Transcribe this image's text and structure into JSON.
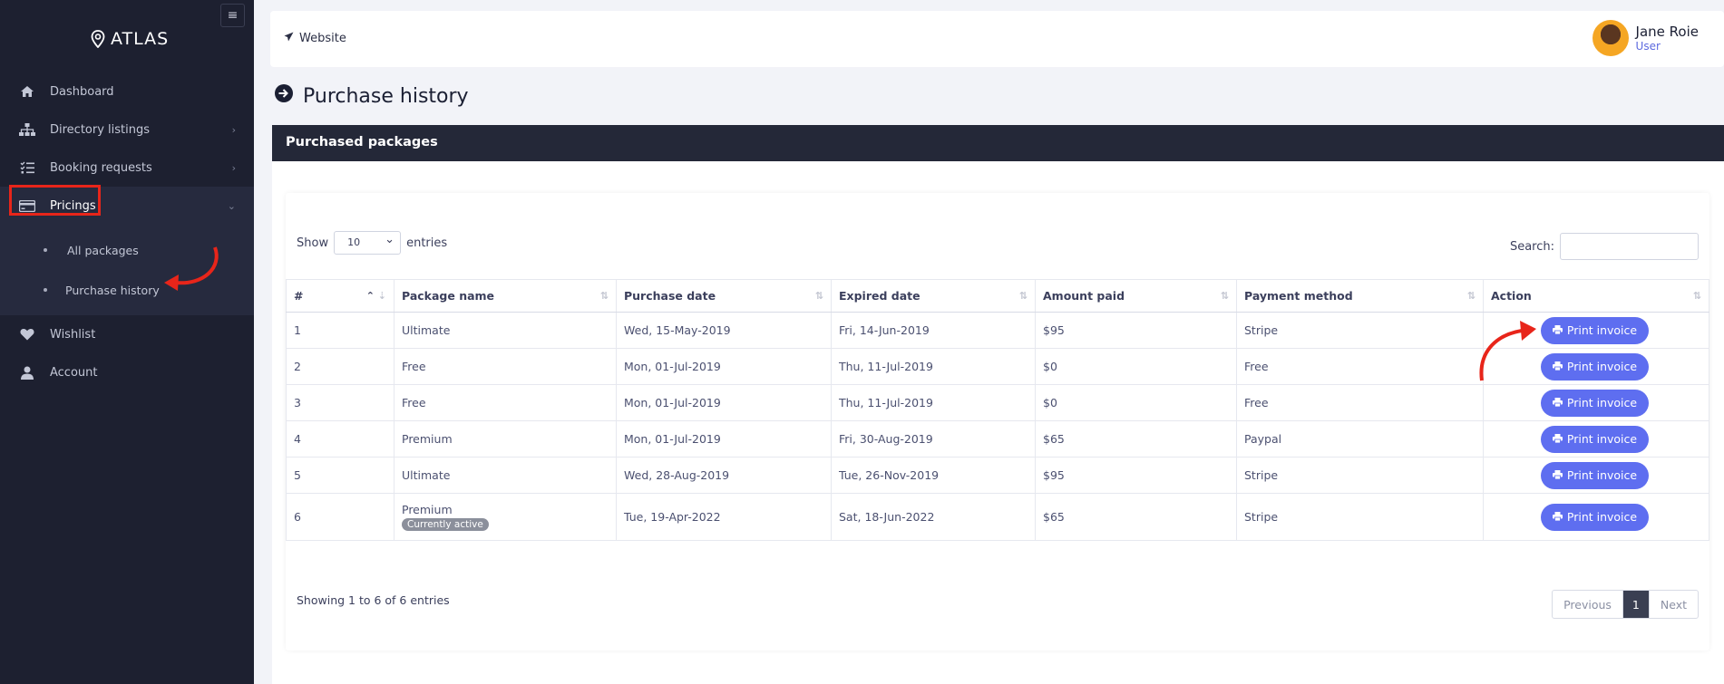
{
  "app": {
    "logo_text": "ATLAS"
  },
  "sidebar": {
    "items": [
      {
        "label": "Dashboard",
        "icon": "home-icon"
      },
      {
        "label": "Directory listings",
        "icon": "sitemap-icon"
      },
      {
        "label": "Booking requests",
        "icon": "tasks-icon"
      },
      {
        "label": "Pricings",
        "icon": "credit-card-icon",
        "active": true
      },
      {
        "label": "Wishlist",
        "icon": "heart-icon"
      },
      {
        "label": "Account",
        "icon": "user-icon"
      }
    ],
    "submenu": [
      {
        "label": "All packages"
      },
      {
        "label": "Purchase history",
        "active": true
      }
    ]
  },
  "topbar": {
    "website_label": "Website",
    "user_name": "Jane Roie",
    "user_role": "User"
  },
  "page": {
    "title": "Purchase history"
  },
  "card": {
    "header": "Purchased packages"
  },
  "table_controls": {
    "show_label": "Show",
    "show_value": "10",
    "entries_label": "entries",
    "search_label": "Search:"
  },
  "table": {
    "columns": [
      "#",
      "Package name",
      "Purchase date",
      "Expired date",
      "Amount paid",
      "Payment method",
      "Action"
    ],
    "rows": [
      {
        "num": "1",
        "package": "Ultimate",
        "purchase": "Wed, 15-May-2019",
        "expired": "Fri, 14-Jun-2019",
        "amount": "$95",
        "method": "Stripe",
        "action": "Print invoice"
      },
      {
        "num": "2",
        "package": "Free",
        "purchase": "Mon, 01-Jul-2019",
        "expired": "Thu, 11-Jul-2019",
        "amount": "$0",
        "method": "Free",
        "action": "Print invoice"
      },
      {
        "num": "3",
        "package": "Free",
        "purchase": "Mon, 01-Jul-2019",
        "expired": "Thu, 11-Jul-2019",
        "amount": "$0",
        "method": "Free",
        "action": "Print invoice"
      },
      {
        "num": "4",
        "package": "Premium",
        "purchase": "Mon, 01-Jul-2019",
        "expired": "Fri, 30-Aug-2019",
        "amount": "$65",
        "method": "Paypal",
        "action": "Print invoice"
      },
      {
        "num": "5",
        "package": "Ultimate",
        "purchase": "Wed, 28-Aug-2019",
        "expired": "Tue, 26-Nov-2019",
        "amount": "$95",
        "method": "Stripe",
        "action": "Print invoice"
      },
      {
        "num": "6",
        "package": "Premium",
        "badge": "Currently active",
        "purchase": "Tue, 19-Apr-2022",
        "expired": "Sat, 18-Jun-2022",
        "amount": "$65",
        "method": "Stripe",
        "action": "Print invoice"
      }
    ]
  },
  "footer": {
    "info": "Showing 1 to 6 of 6 entries",
    "prev": "Previous",
    "current_page": "1",
    "next": "Next"
  },
  "colors": {
    "sidebar_bg": "#1d2030",
    "accent": "#5e6ef0",
    "highlight": "#e8251a",
    "header_bg": "#242838"
  }
}
